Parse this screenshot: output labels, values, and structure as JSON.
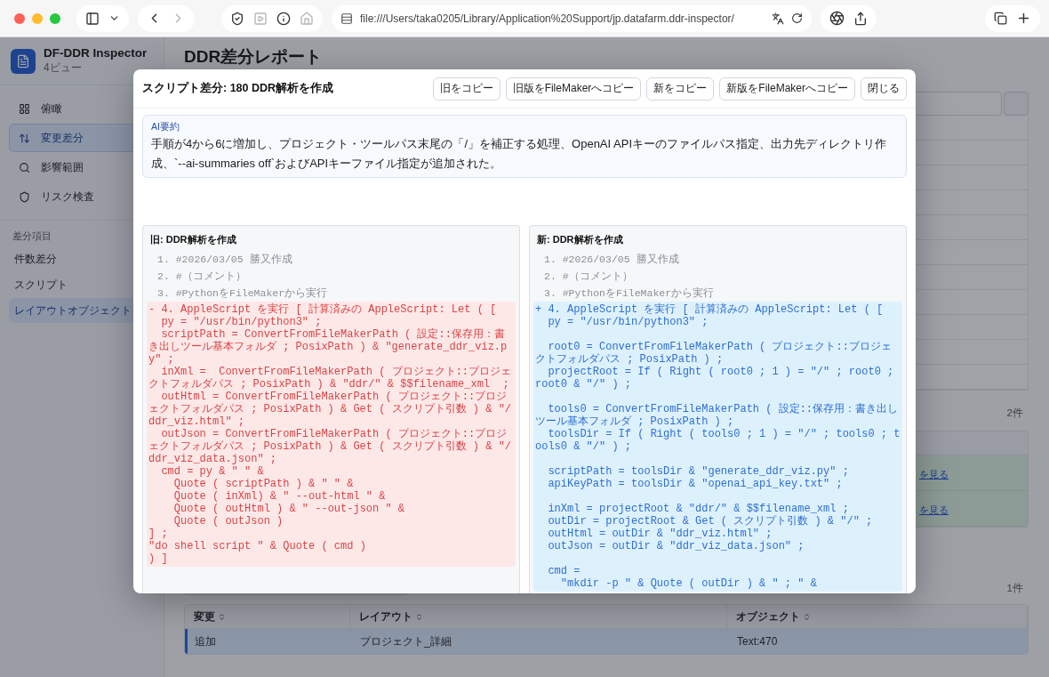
{
  "browser": {
    "url": "file:///Users/taka0205/Library/Application%20Support/jp.datafarm.ddr-inspector/"
  },
  "sidebar": {
    "app_name": "DF-DDR Inspector",
    "subtitle": "4ビュー",
    "views": [
      {
        "label": "俯瞰",
        "selected": false
      },
      {
        "label": "変更差分",
        "selected": true
      },
      {
        "label": "影響範囲",
        "selected": false
      },
      {
        "label": "リスク検査",
        "selected": false
      }
    ],
    "section_title": "差分項目",
    "sections": [
      {
        "label": "件数差分",
        "selected": false
      },
      {
        "label": "スクリプト",
        "selected": false
      },
      {
        "label": "レイアウトオブジェクト",
        "selected": true
      }
    ]
  },
  "page": {
    "title": "DDR差分レポート",
    "scripts": {
      "count": "2件",
      "rows": [
        {
          "link": "を見る"
        },
        {
          "link": "を見る"
        }
      ]
    },
    "layout_objects": {
      "count": "1件",
      "columns": [
        "変更",
        "レイアウト",
        "オブジェクト"
      ],
      "rows": [
        {
          "cells": [
            "追加",
            "プロジェクト_詳細",
            "Text:470"
          ],
          "selected": true
        }
      ]
    }
  },
  "modal": {
    "title": "スクリプト差分: 180 DDR解析を作成",
    "buttons": [
      "旧をコピー",
      "旧版をFileMakerへコピー",
      "新をコピー",
      "新版をFileMakerへコピー",
      "閉じる"
    ],
    "summary": {
      "label": "AI要約",
      "text": "手順が4から6に増加し、プロジェクト・ツールパス末尾の「/」を補正する処理、OpenAI APIキーのファイルパス指定、出力先ディレクトリ作成、`--ai-summaries off`およびAPIキーファイル指定が追加された。"
    },
    "panes": [
      {
        "title": "旧: DDR解析を作成",
        "lines": [
          {
            "kind": "context",
            "text": "1. #2026/03/05 勝又作成"
          },
          {
            "kind": "context",
            "text": "2. #（コメント）"
          },
          {
            "kind": "context",
            "text": "3. #PythonをFileMakerから実行"
          },
          {
            "kind": "removed",
            "groups": [
              {
                "lines": [
                  "- 4. AppleScript を実行 [ 計算済みの AppleScript: Let ( [",
                  "  py = \"/usr/bin/python3\" ;",
                  "  scriptPath = ConvertFromFileMakerPath ( 設定::保存用：書き出しツール基本フォルダ ; PosixPath ) & \"generate_ddr_viz.py\" ;",
                  "  inXml =  ConvertFromFileMakerPath ( プロジェクト::プロジェクトフォルダパス ; PosixPath ) & \"ddr/\" & $$filename_xml  ;",
                  "  outHtml = ConvertFromFileMakerPath ( プロジェクト::プロジェクトフォルダパス ; PosixPath ) & Get ( スクリプト引数 ) & \"/ddr_viz.html\" ;",
                  "  outJson = ConvertFromFileMakerPath ( プロジェクト::プロジェクトフォルダパス ; PosixPath ) & Get ( スクリプト引数 ) & \"/ddr_viz_data.json\" ;",
                  "  cmd = py & \" \" &",
                  "    Quote ( scriptPath ) & \" \" &",
                  "    Quote ( inXml) & \" --out-html \" &",
                  "    Quote ( outHtml ) & \" --out-json \" &",
                  "    Quote ( outJson )",
                  "] ;",
                  "\"do shell script \" & Quote ( cmd )",
                  ") ]"
                ]
              }
            ]
          }
        ]
      },
      {
        "title": "新: DDR解析を作成",
        "lines": [
          {
            "kind": "context",
            "text": "1. #2026/03/05 勝又作成"
          },
          {
            "kind": "context",
            "text": "2. #（コメント）"
          },
          {
            "kind": "context",
            "text": "3. #PythonをFileMakerから実行"
          },
          {
            "kind": "added",
            "groups": [
              {
                "lines": [
                  "+ 4. AppleScript を実行 [ 計算済みの AppleScript: Let ( [",
                  "  py = \"/usr/bin/python3\" ;"
                ]
              },
              {
                "lines": [
                  "  root0 = ConvertFromFileMakerPath ( プロジェクト::プロジェクトフォルダパス ; PosixPath ) ;",
                  "  projectRoot = If ( Right ( root0 ; 1 ) = \"/\" ; root0 ; root0 & \"/\" ) ;"
                ]
              },
              {
                "lines": [
                  "  tools0 = ConvertFromFileMakerPath ( 設定::保存用：書き出しツール基本フォルダ ; PosixPath ) ;",
                  "  toolsDir = If ( Right ( tools0 ; 1 ) = \"/\" ; tools0 ; tools0 & \"/\" ) ;"
                ]
              },
              {
                "lines": [
                  "  scriptPath = toolsDir & \"generate_ddr_viz.py\" ;",
                  "  apiKeyPath = toolsDir & \"openai_api_key.txt\" ;"
                ]
              },
              {
                "lines": [
                  "  inXml = projectRoot & \"ddr/\" & $$filename_xml ;",
                  "  outDir = projectRoot & Get ( スクリプト引数 ) & \"/\" ;",
                  "  outHtml = outDir & \"ddr_viz.html\" ;",
                  "  outJson = outDir & \"ddr_viz_data.json\" ;"
                ]
              },
              {
                "lines": [
                  "  cmd =",
                  "    \"mkdir -p \" & Quote ( outDir ) & \" ; \" &"
                ]
              }
            ]
          }
        ]
      }
    ]
  }
}
